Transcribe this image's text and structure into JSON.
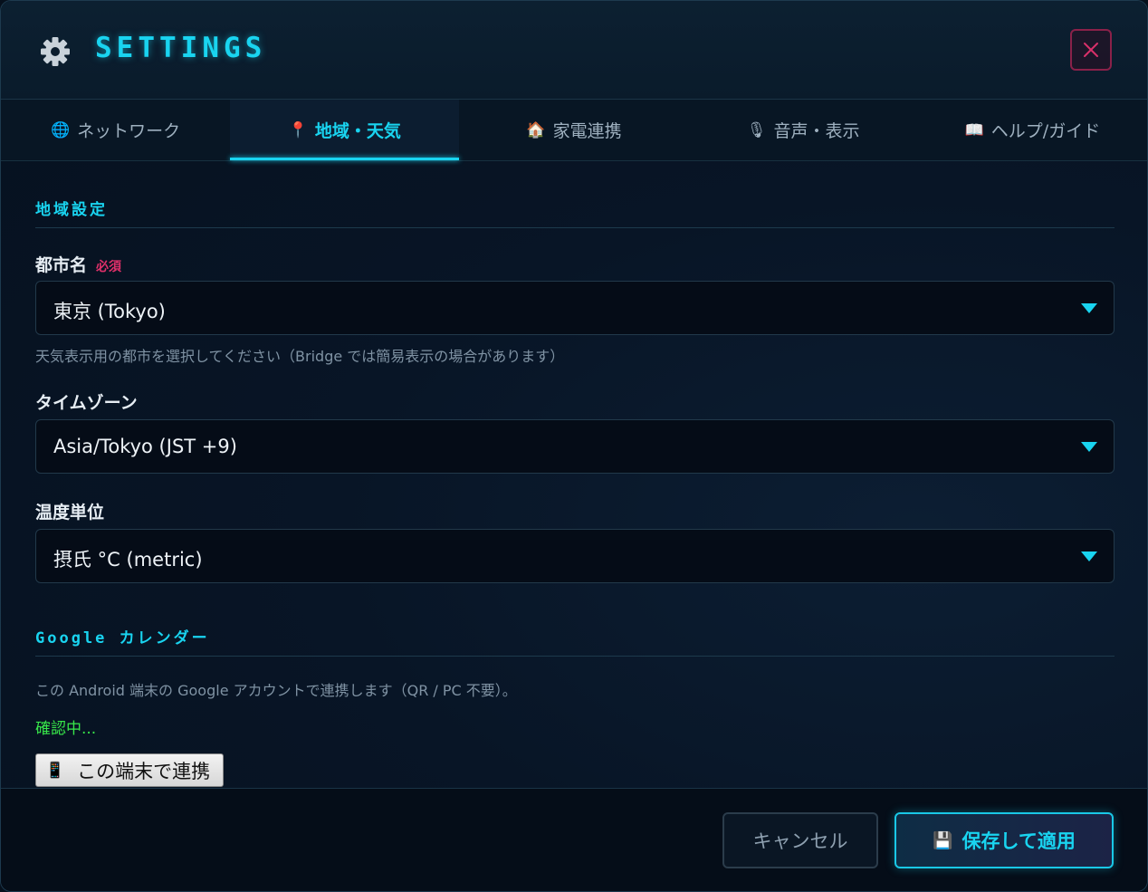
{
  "header": {
    "title": "SETTINGS",
    "gear_icon": "gear-icon",
    "close_icon": "close-icon",
    "accent": "#19d4f0",
    "close_color": "#d8306a"
  },
  "tabs": [
    {
      "icon": "🌐",
      "label": "ネットワーク",
      "active": false
    },
    {
      "icon": "📍",
      "label": "地域・天気",
      "active": true
    },
    {
      "icon": "🏠",
      "label": "家電連携",
      "active": false
    },
    {
      "icon": "🎙",
      "label": "音声・表示",
      "active": false
    },
    {
      "icon": "📖",
      "label": "ヘルプ/ガイド",
      "active": false
    }
  ],
  "region": {
    "section_title": "地域設定",
    "city": {
      "label": "都市名",
      "required": "必須",
      "value": "東京 (Tokyo)",
      "hint": "天気表示用の都市を選択してください（Bridge では簡易表示の場合があります）"
    },
    "timezone": {
      "label": "タイムゾーン",
      "value": "Asia/Tokyo (JST +9)"
    },
    "temperature": {
      "label": "温度単位",
      "value": "摂氏 °C (metric)"
    }
  },
  "calendar": {
    "section_title": "Google カレンダー",
    "description": "この Android 端末の Google アカウントで連携します（QR / PC 不要）。",
    "status": "確認中...",
    "status_color": "#38e84a",
    "link_button_icon": "📱",
    "link_button_label": "この端末で連携"
  },
  "footer": {
    "cancel_label": "キャンセル",
    "save_icon": "💾",
    "save_label": "保存して適用"
  }
}
